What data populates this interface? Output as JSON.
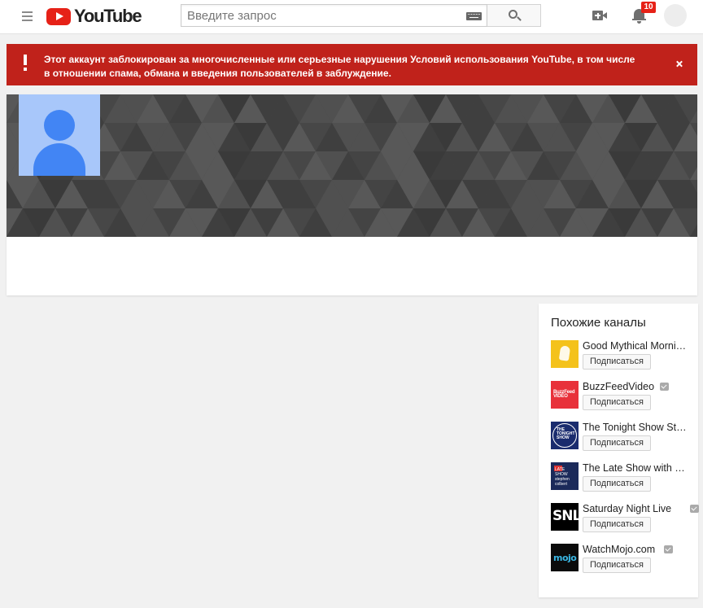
{
  "header": {
    "logo_text": "YouTube",
    "search_placeholder": "Введите запрос",
    "notifications_count": "10"
  },
  "alert": {
    "message": "Этот аккаунт заблокирован за многочисленные или серьезные нарушения Условий использования YouTube, в том числе в отношении спама, обмана и введения пользователей в заблуждение.",
    "color": "#c0221b"
  },
  "related": {
    "title": "Похожие каналы",
    "subscribe_label": "Подписаться",
    "channels": [
      {
        "name": "Good Mythical Morning",
        "verified": false,
        "icon": "good-mythical-morning-logo"
      },
      {
        "name": "BuzzFeedVideo",
        "verified": true,
        "icon": "buzzfeed-video-logo",
        "thumb_text": "BuzzFeed VIDEO"
      },
      {
        "name": "The Tonight Show Starring Jimmy Fallon",
        "verified": false,
        "icon": "tonight-show-logo",
        "thumb_text": "THE TONIGHT SHOW"
      },
      {
        "name": "The Late Show with Stephen Colbert",
        "verified": false,
        "icon": "late-show-logo",
        "thumb_text": "LATE SHOW stephen colbert"
      },
      {
        "name": "Saturday Night Live",
        "verified": true,
        "icon": "snl-logo",
        "thumb_text": "SNL"
      },
      {
        "name": "WatchMojo.com",
        "verified": true,
        "icon": "watchmojo-logo",
        "thumb_text": "mojo"
      }
    ]
  },
  "colors": {
    "brand_red": "#e62117",
    "avatar_bg": "#a8c7fa",
    "avatar_fg": "#4285f4",
    "banner": "#4a4a4a"
  }
}
